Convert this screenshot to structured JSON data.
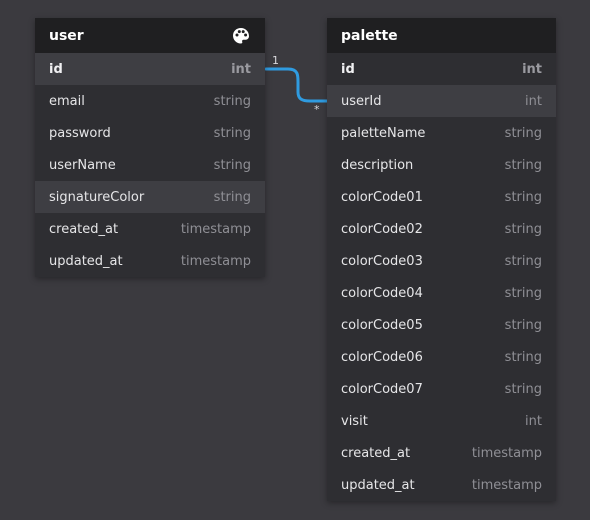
{
  "tables": {
    "user": {
      "title": "user",
      "icon": "palette-icon",
      "fields": [
        {
          "name": "id",
          "type": "int"
        },
        {
          "name": "email",
          "type": "string"
        },
        {
          "name": "password",
          "type": "string"
        },
        {
          "name": "userName",
          "type": "string"
        },
        {
          "name": "signatureColor",
          "type": "string"
        },
        {
          "name": "created_at",
          "type": "timestamp"
        },
        {
          "name": "updated_at",
          "type": "timestamp"
        }
      ]
    },
    "palette": {
      "title": "palette",
      "fields": [
        {
          "name": "id",
          "type": "int"
        },
        {
          "name": "userId",
          "type": "int"
        },
        {
          "name": "paletteName",
          "type": "string"
        },
        {
          "name": "description",
          "type": "string"
        },
        {
          "name": "colorCode01",
          "type": "string"
        },
        {
          "name": "colorCode02",
          "type": "string"
        },
        {
          "name": "colorCode03",
          "type": "string"
        },
        {
          "name": "colorCode04",
          "type": "string"
        },
        {
          "name": "colorCode05",
          "type": "string"
        },
        {
          "name": "colorCode06",
          "type": "string"
        },
        {
          "name": "colorCode07",
          "type": "string"
        },
        {
          "name": "visit",
          "type": "int"
        },
        {
          "name": "created_at",
          "type": "timestamp"
        },
        {
          "name": "updated_at",
          "type": "timestamp"
        }
      ]
    }
  },
  "relation": {
    "from_table": "user",
    "from_field": "id",
    "to_table": "palette",
    "to_field": "userId",
    "from_cardinality": "1",
    "to_cardinality": "*"
  },
  "colors": {
    "background": "#3b3a3f",
    "table_body": "#2e2e32",
    "table_header": "#1f1f21",
    "highlight_row": "#3e3e43",
    "connector": "#2f9be0"
  }
}
